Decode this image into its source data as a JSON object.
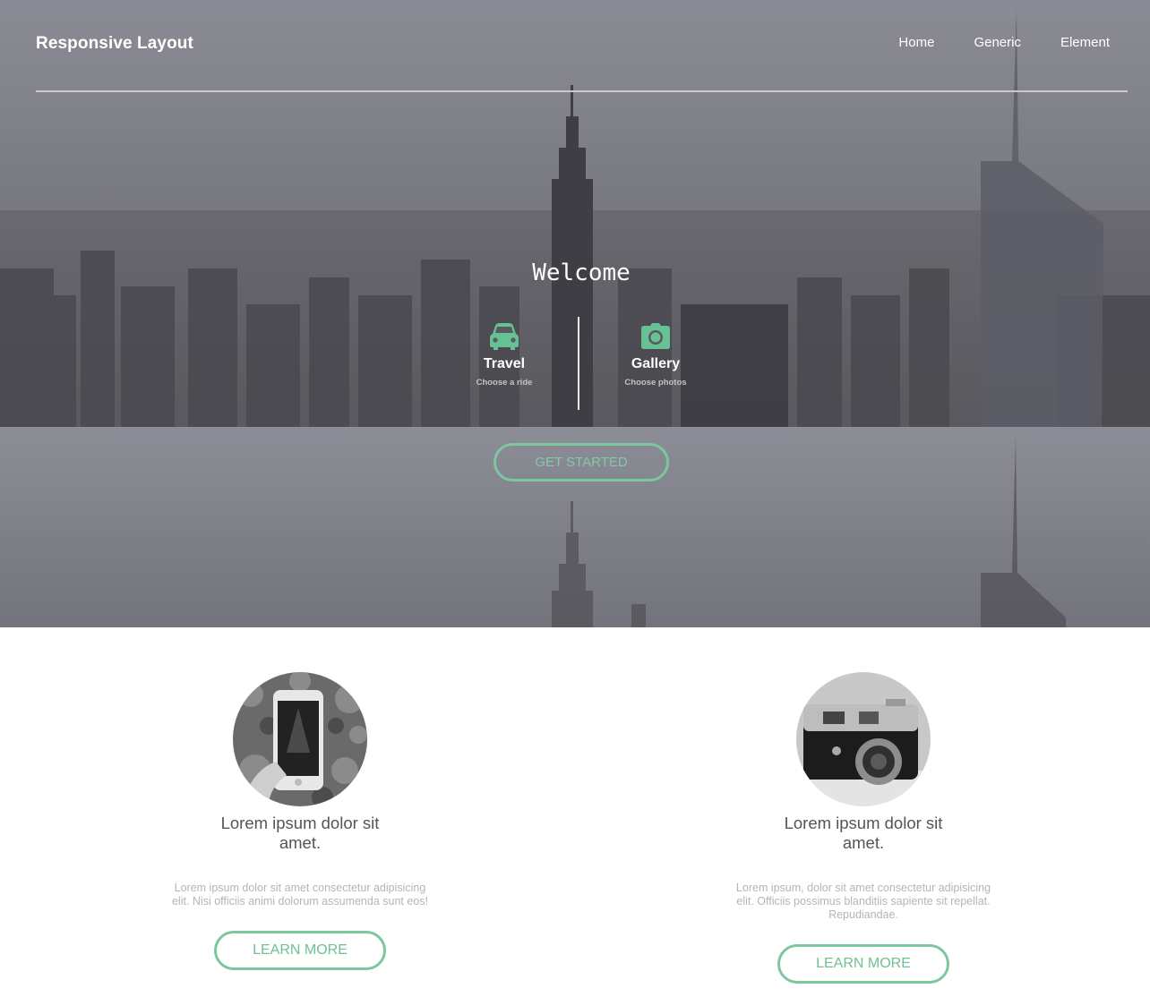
{
  "header": {
    "brand": "Responsive Layout",
    "nav": [
      {
        "label": "Home"
      },
      {
        "label": "Generic"
      },
      {
        "label": "Element"
      }
    ]
  },
  "hero": {
    "title": "Welcome",
    "features": [
      {
        "title": "Travel",
        "subtitle": "Choose a ride",
        "icon": "car-icon"
      },
      {
        "title": "Gallery",
        "subtitle": "Choose photos",
        "icon": "camera-icon"
      }
    ],
    "cta_label": "GET STARTED"
  },
  "cards": [
    {
      "image": "phone-photo",
      "title": "Lorem ipsum dolor sit amet.",
      "text": "Lorem ipsum dolor sit amet consectetur adipisicing elit. Nisi officiis animi dolorum assumenda sunt eos!",
      "button_label": "LEARN MORE"
    },
    {
      "image": "camera-photo",
      "title": "Lorem ipsum dolor sit amet.",
      "text": "Lorem ipsum, dolor sit amet consectetur adipisicing elit. Officiis possimus blanditiis sapiente sit repellat. Repudiandae.",
      "button_label": "LEARN MORE"
    }
  ],
  "colors": {
    "accent": "#7bc7a0",
    "hero_overlay": "#85858f",
    "text_dark": "#555555",
    "text_muted": "#b5b5b5"
  }
}
